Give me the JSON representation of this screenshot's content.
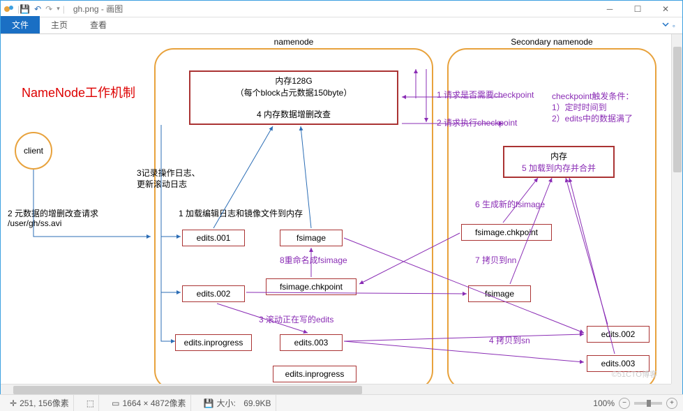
{
  "window": {
    "filename": "gh.png",
    "app": "画图",
    "title_sep": " - "
  },
  "ribbon": {
    "file": "文件",
    "home": "主页",
    "view": "查看"
  },
  "status": {
    "coords": "251, 156像素",
    "coords_suffix": "",
    "dims": "1664 × 4872像素",
    "size_label": "大小:",
    "size_value": "69.9KB",
    "zoom": "100%"
  },
  "diagram": {
    "title": "NameNode工作机制",
    "client": "client",
    "namenode_label": "namenode",
    "secondary_label": "Secondary namenode",
    "mem_box_l1": "内存128G",
    "mem_box_l2": "（每个block占元数据150byte）",
    "mem_box_l3": "4 内存数据增删改查",
    "snn_mem_l1": "内存",
    "snn_mem_l2": "5 加载到内存并合并",
    "step1": "1 请求是否需要checkpoint",
    "step2": "2 请求执行checkpoint",
    "step3_1": "3记录操作日志、",
    "step3_2": "更新滚动日志",
    "step_load": "1 加载编辑日志和镜像文件到内存",
    "step_req": "2 元数据的增删改查请求",
    "step_req_path": "/user/gh/ss.avi",
    "step_roll": "3 滚动正在写的edits",
    "step_copy_sn": "4 拷贝到sn",
    "step_gen": "6 生成新的fsimage",
    "step_copy_nn": "7 拷贝到nn",
    "step_rename": "8重命名成fsimage",
    "trigger_l1": "checkpoint触发条件：",
    "trigger_l2": "1）定时时间到",
    "trigger_l3": "2）edits中的数据满了",
    "boxes": {
      "edits001": "edits.001",
      "edits002": "edits.002",
      "edits_inprog": "edits.inprogress",
      "edits003": "edits.003",
      "edits_inprog2": "edits.inprogress",
      "fsimage": "fsimage",
      "fsimage_chk": "fsimage.chkpoint",
      "snn_fsimage_chk": "fsimage.chkpoint",
      "snn_fsimage": "fsimage",
      "snn_edits002": "edits.002",
      "snn_edits003": "edits.003"
    }
  },
  "watermark": "©51CTO博客"
}
